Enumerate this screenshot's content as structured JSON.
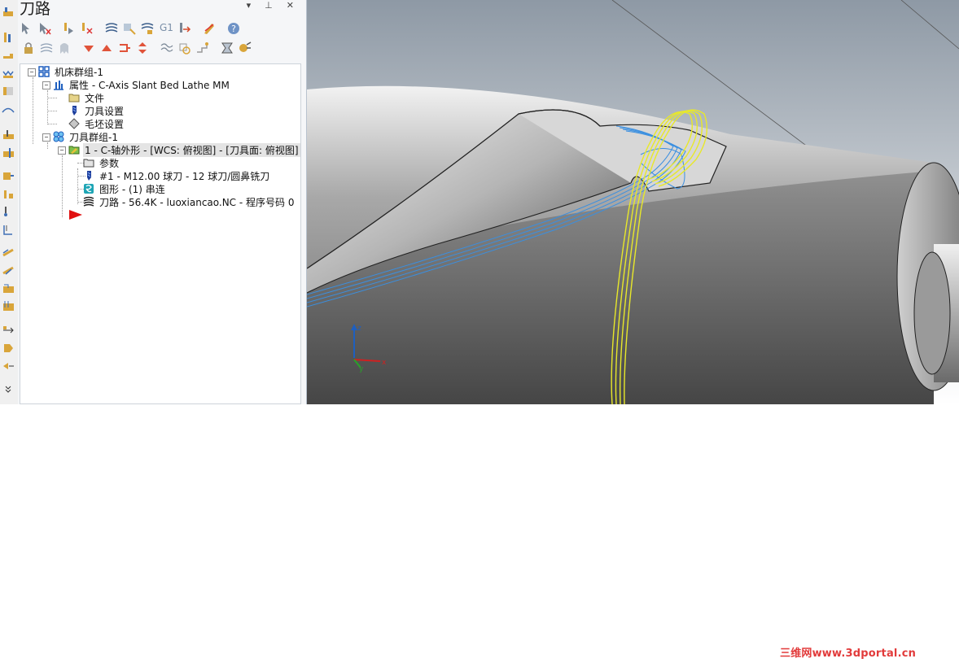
{
  "panel": {
    "title": "刀路",
    "controls": "▾ ⊥ ✕"
  },
  "toolbar_row1_icons": [
    "select-all-icon",
    "deselect-icon",
    "select-tool-icon",
    "clear-tool-icon",
    "regen-all-icon",
    "regen-dirty-icon",
    "regen-selected-icon",
    "g1-icon",
    "post-icon",
    "highlight-icon",
    "help-icon"
  ],
  "toolbar_row2_icons": [
    "lock-icon",
    "toggle-display-icon",
    "toggle-post-icon",
    "move-down-icon",
    "move-up-icon",
    "insert-arrow-icon",
    "scroll-icon",
    "wave-icon",
    "stock-icon",
    "backplot-icon",
    "verify-icon",
    "simulate-icon"
  ],
  "toolbar_row1_g1": "G1",
  "tree": {
    "machine_group": "机床群组-1",
    "properties": "属性 - C-Axis Slant Bed Lathe MM",
    "files": "文件",
    "tool_settings": "刀具设置",
    "stock_setup": "毛坯设置",
    "toolpath_group": "刀具群组-1",
    "operation": "1 - C-轴外形 - [WCS: 俯视图] - [刀具面: 俯视图]",
    "parameters": "参数",
    "tool": "#1 - M12.00 球刀 - 12 球刀/圆鼻铣刀",
    "geometry": "图形 - (1) 串连",
    "toolpath": "刀路 - 56.4K - luoxiancao.NC - 程序号码 0"
  },
  "axes": {
    "x": "x",
    "y": "y",
    "z": "z"
  },
  "watermark": "三维网www.3dportal.cn",
  "colors": {
    "accent_blue": "#1e5fbf",
    "toolpath_blue": "#3a8fe0",
    "toolpath_yellow": "#e8e82a",
    "insert_arrow": "#e01010"
  }
}
